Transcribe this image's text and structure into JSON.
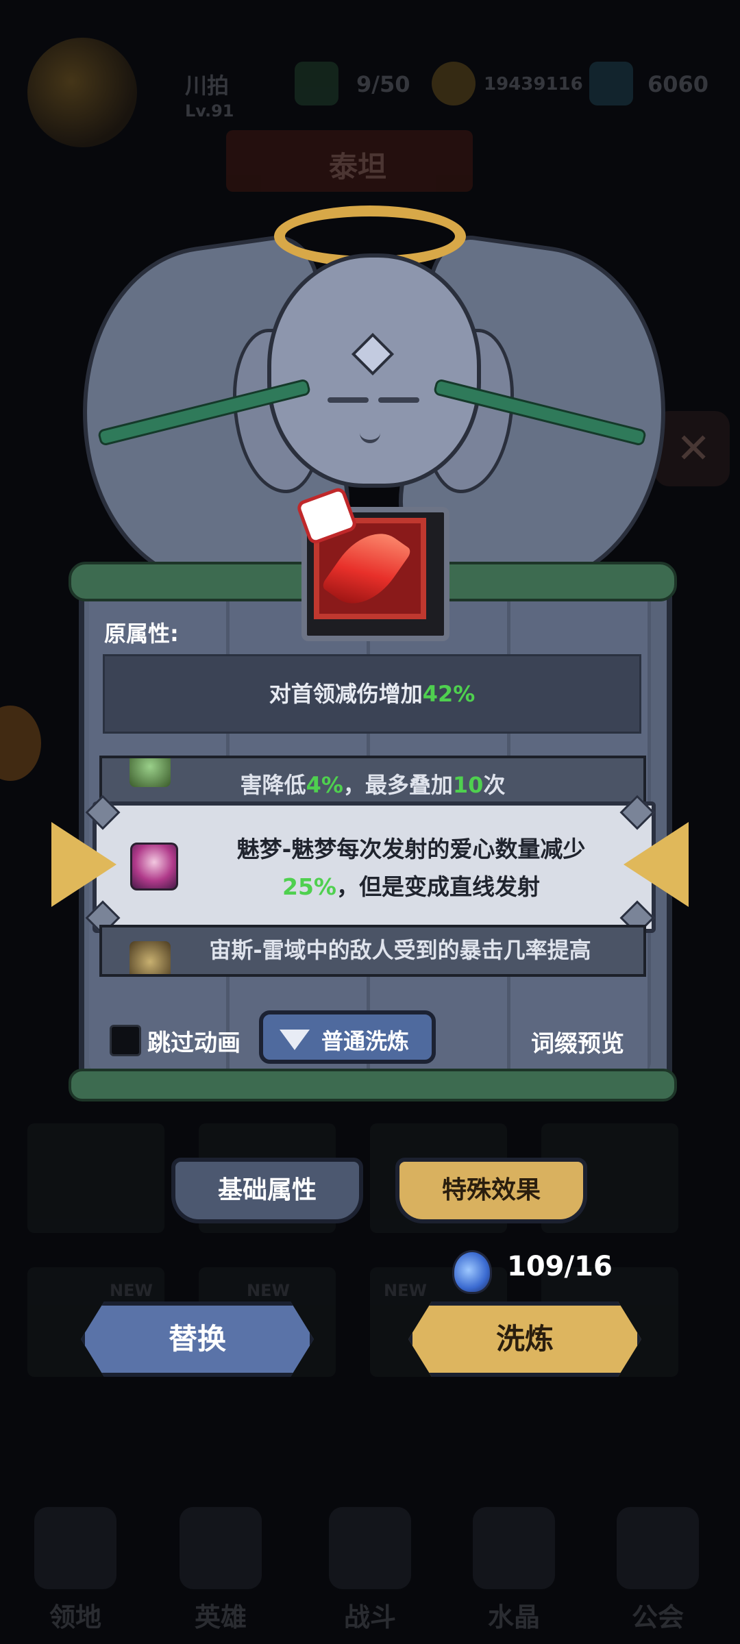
{
  "background": {
    "player_name": "川拍",
    "player_level": "Lv.91",
    "stamina": "9/50",
    "coins": "19439116",
    "gems": "6060",
    "banner_text": "泰坦",
    "bottom_nav": [
      "领地",
      "英雄",
      "战斗",
      "水晶",
      "公会"
    ],
    "new_tag": "NEW"
  },
  "panel": {
    "original_label": "原属性:",
    "original_prefix": "对首领减伤增加",
    "original_value": "42%",
    "rows": {
      "top_partial": {
        "prefix": "害降低",
        "v1": "4%",
        "mid": "，最多叠加",
        "v2": "10",
        "suffix": "次"
      },
      "selected": {
        "line1": "魅梦-魅梦每次发射的爱心数量减少",
        "line2_value": "25%",
        "line2_rest": "，但是变成直线发射"
      },
      "bottom_partial": {
        "text": "宙斯-雷域中的敌人受到的暴击几率提高"
      }
    },
    "skip_animation_label": "跳过动画",
    "normal_refine_label": "普通洗炼",
    "affix_preview_label": "词缀预览"
  },
  "tabs": {
    "basic_label": "基础属性",
    "special_label": "特殊效果"
  },
  "cost": {
    "count": "109/16"
  },
  "actions": {
    "replace_label": "替换",
    "refine_label": "洗炼"
  },
  "colors": {
    "highlight_green": "#4fd04f",
    "gold_accent": "#ddb55f",
    "blue_button": "#5a73a8"
  }
}
